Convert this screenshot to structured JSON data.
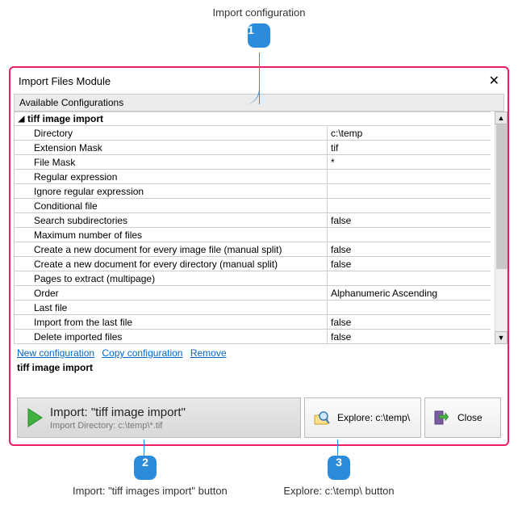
{
  "annotation": {
    "top": "Import configuration",
    "c1": "1",
    "c2": "2",
    "c3": "3",
    "bottom_2": "Import: \"tiff images import\" button",
    "bottom_3": "Explore: c:\\temp\\ button"
  },
  "window": {
    "title": "Import Files Module",
    "section": "Available Configurations",
    "config_name": "tiff image import",
    "rows": [
      {
        "k": "Directory",
        "v": "c:\\temp"
      },
      {
        "k": "Extension Mask",
        "v": "tif"
      },
      {
        "k": "File Mask",
        "v": "*"
      },
      {
        "k": "Regular expression",
        "v": ""
      },
      {
        "k": "Ignore regular expression",
        "v": ""
      },
      {
        "k": "Conditional file",
        "v": ""
      },
      {
        "k": "Search subdirectories",
        "v": "false"
      },
      {
        "k": "Maximum number of files",
        "v": ""
      },
      {
        "k": "Create a new document for every image file (manual split)",
        "v": "false"
      },
      {
        "k": "Create a new document for every directory (manual split)",
        "v": "false"
      },
      {
        "k": "Pages to extract (multipage)",
        "v": ""
      },
      {
        "k": "Order",
        "v": "Alphanumeric Ascending"
      },
      {
        "k": "Last file",
        "v": ""
      },
      {
        "k": "Import from the last file",
        "v": "false"
      },
      {
        "k": "Delete imported files",
        "v": "false"
      }
    ],
    "links": {
      "new": "New configuration",
      "copy": "Copy configuration",
      "remove": "Remove"
    },
    "selected": "tiff image import",
    "buttons": {
      "import_title": "Import: \"tiff image import\"",
      "import_sub": "Import Directory: c:\\temp\\*.tif",
      "explore": "Explore: c:\\temp\\",
      "close": "Close"
    }
  }
}
